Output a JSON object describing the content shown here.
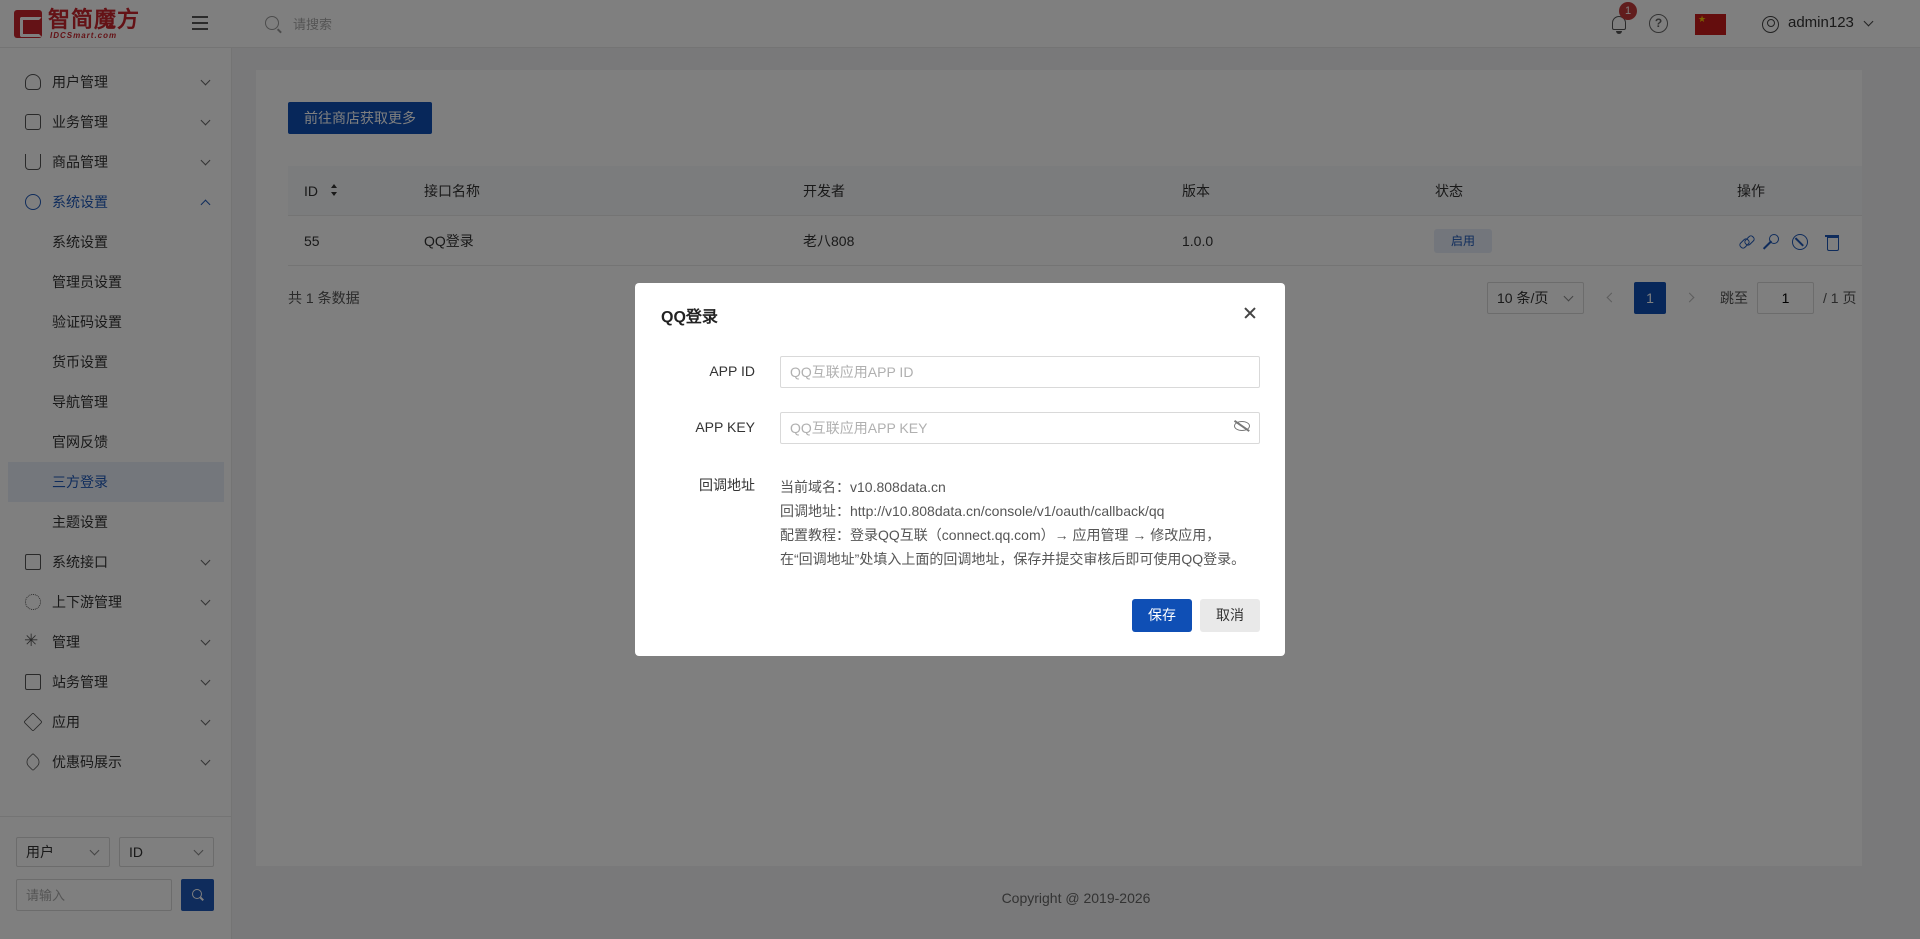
{
  "header": {
    "logo_text": "智简魔方",
    "logo_sub": "IDCSmart.com",
    "search_placeholder": "请搜索",
    "notification_count": "1",
    "help_glyph": "?",
    "username": "admin123",
    "flag": "china-flag"
  },
  "sidebar": {
    "items": [
      {
        "label": "用户管理",
        "icon": "user-icon"
      },
      {
        "label": "业务管理",
        "icon": "list-icon"
      },
      {
        "label": "商品管理",
        "icon": "cart-icon"
      },
      {
        "label": "系统设置",
        "icon": "gear-icon"
      },
      {
        "label": "系统接口",
        "icon": "folder-icon"
      },
      {
        "label": "上下游管理",
        "icon": "network-icon"
      },
      {
        "label": "管理",
        "icon": "asterisk-icon"
      },
      {
        "label": "站务管理",
        "icon": "folder-plus-icon"
      },
      {
        "label": "应用",
        "icon": "cube-icon"
      },
      {
        "label": "优惠码展示",
        "icon": "tag-icon"
      }
    ],
    "sub_items": [
      "系统设置",
      "管理员设置",
      "验证码设置",
      "货币设置",
      "导航管理",
      "官网反馈",
      "三方登录",
      "主题设置"
    ],
    "bottom": {
      "type_select": "用户",
      "field_select": "ID",
      "keyword_placeholder": "请输入"
    }
  },
  "main": {
    "shop_button": "前往商店获取更多",
    "table": {
      "columns": [
        "ID",
        "接口名称",
        "开发者",
        "版本",
        "状态",
        "操作"
      ],
      "rows": [
        {
          "id": "55",
          "name": "QQ登录",
          "developer": "老八808",
          "version": "1.0.0",
          "status": "启用"
        }
      ]
    },
    "total": "共 1 条数据",
    "pagination": {
      "page_size": "10 条/页",
      "current_page": "1",
      "jump_label": "跳至",
      "jump_value": "1",
      "page_total": "/ 1 页"
    }
  },
  "footer": "Copyright @ 2019-2026",
  "modal": {
    "title": "QQ登录",
    "app_id_label": "APP ID",
    "app_id_placeholder": "QQ互联应用APP ID",
    "app_key_label": "APP KEY",
    "app_key_placeholder": "QQ互联应用APP KEY",
    "callback_label": "回调地址",
    "info_lines": [
      "当前域名：v10.808data.cn",
      "回调地址：http://v10.808data.cn/console/v1/oauth/callback/qq",
      "配置教程：登录QQ互联（connect.qq.com）→ 应用管理 → 修改应用，",
      "在“回调地址”处填入上面的回调地址，保存并提交审核后即可使用QQ登录。"
    ],
    "save_label": "保存",
    "cancel_label": "取消"
  },
  "colors": {
    "primary": "#0f4fb5",
    "brand_red": "#c9252c",
    "badge_red": "#c23a3a"
  }
}
